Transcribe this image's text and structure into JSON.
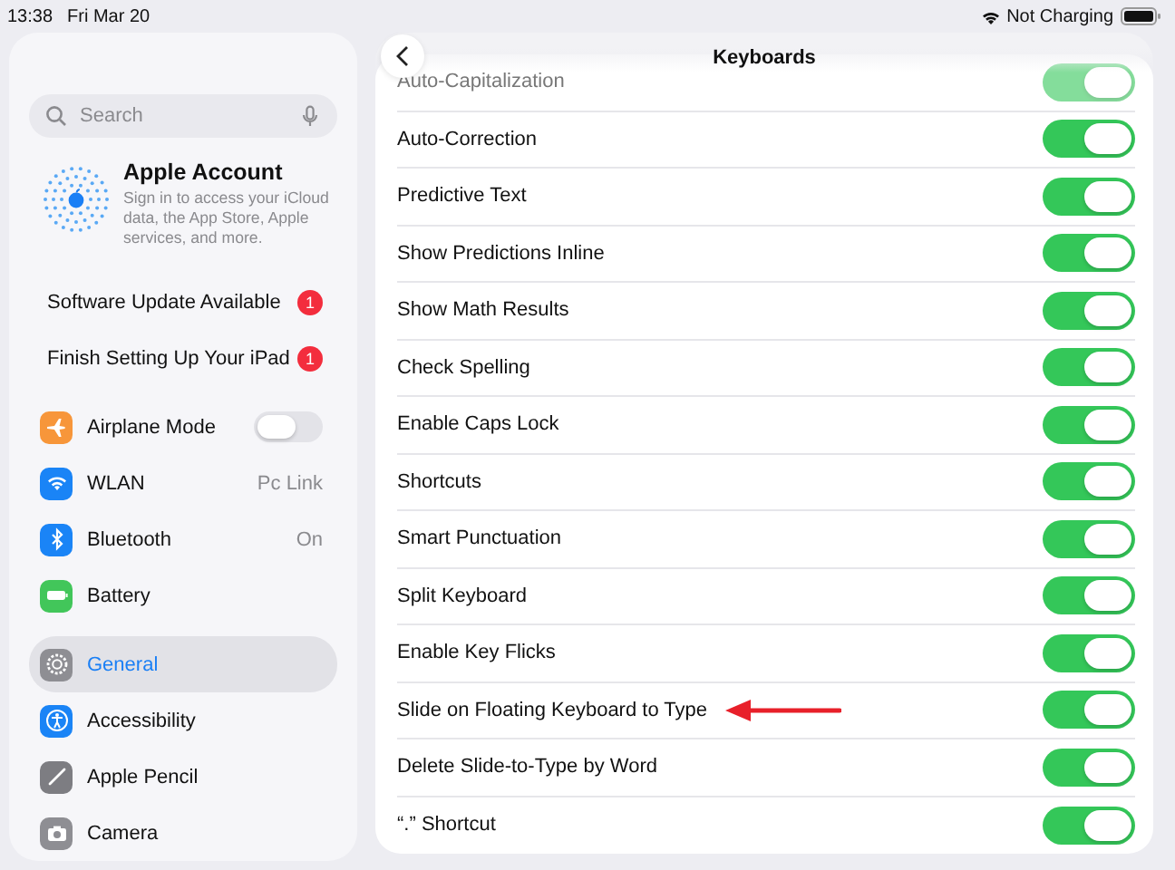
{
  "status_bar": {
    "time": "13:38",
    "date": "Fri Mar 20",
    "battery_text": "Not Charging"
  },
  "sidebar": {
    "search": {
      "placeholder": "Search"
    },
    "account": {
      "title": "Apple Account",
      "subtitle": "Sign in to access your iCloud data, the App Store, Apple services, and more."
    },
    "alerts": [
      {
        "label": "Software Update Available",
        "badge": "1"
      },
      {
        "label": "Finish Setting Up Your iPad",
        "badge": "1"
      }
    ],
    "groups": [
      [
        {
          "label": "Airplane Mode",
          "kind": "toggle",
          "on": false,
          "color": "#f7963a",
          "selected": false
        },
        {
          "label": "WLAN",
          "kind": "value",
          "value": "Pc Link",
          "color": "#1a84f6",
          "selected": false
        },
        {
          "label": "Bluetooth",
          "kind": "value",
          "value": "On",
          "color": "#1a84f6",
          "selected": false
        },
        {
          "label": "Battery",
          "kind": "plain",
          "color": "#42c65a",
          "selected": false
        }
      ],
      [
        {
          "label": "General",
          "kind": "plain",
          "color": "#8e8e93",
          "selected": true
        },
        {
          "label": "Accessibility",
          "kind": "plain",
          "color": "#1a84f6",
          "selected": false
        },
        {
          "label": "Apple Pencil",
          "kind": "plain",
          "color": "#7d7d82",
          "selected": false
        },
        {
          "label": "Camera",
          "kind": "plain",
          "color": "#8e8e93",
          "selected": false
        }
      ]
    ]
  },
  "detail": {
    "title": "Keyboards",
    "rows": [
      {
        "label": "Auto-Capitalization",
        "on": true,
        "annotated": false
      },
      {
        "label": "Auto-Correction",
        "on": true,
        "annotated": false
      },
      {
        "label": "Predictive Text",
        "on": true,
        "annotated": false
      },
      {
        "label": "Show Predictions Inline",
        "on": true,
        "annotated": false
      },
      {
        "label": "Show Math Results",
        "on": true,
        "annotated": false
      },
      {
        "label": "Check Spelling",
        "on": true,
        "annotated": false
      },
      {
        "label": "Enable Caps Lock",
        "on": true,
        "annotated": false
      },
      {
        "label": "Shortcuts",
        "on": true,
        "annotated": false
      },
      {
        "label": "Smart Punctuation",
        "on": true,
        "annotated": false
      },
      {
        "label": "Split Keyboard",
        "on": true,
        "annotated": false
      },
      {
        "label": "Enable Key Flicks",
        "on": true,
        "annotated": false
      },
      {
        "label": "Slide on Floating Keyboard to Type",
        "on": true,
        "annotated": true
      },
      {
        "label": "Delete Slide-to-Type by Word",
        "on": true,
        "annotated": false
      },
      {
        "label": "“.” Shortcut",
        "on": true,
        "annotated": false
      }
    ]
  }
}
